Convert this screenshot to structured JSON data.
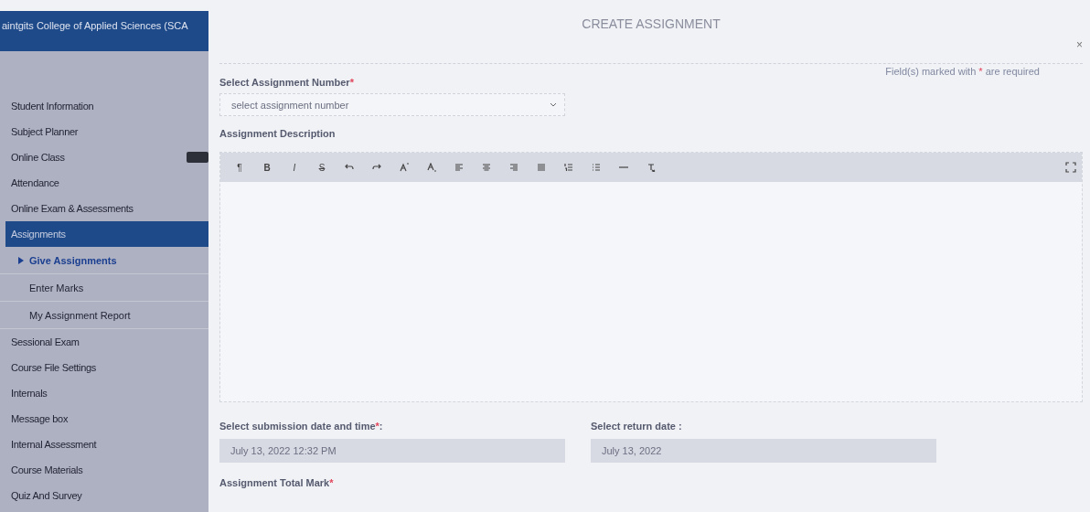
{
  "sidebar": {
    "header": "aintgits College of Applied Sciences (SCA",
    "items": [
      {
        "label": "Student Information",
        "selected": false,
        "badge": false
      },
      {
        "label": "Subject Planner",
        "selected": false,
        "badge": false
      },
      {
        "label": "Online Class",
        "selected": false,
        "badge": true
      },
      {
        "label": "Attendance",
        "selected": false,
        "badge": false
      },
      {
        "label": "Online Exam & Assessments",
        "selected": false,
        "badge": false
      },
      {
        "label": "Assignments",
        "selected": true,
        "badge": false,
        "children": [
          {
            "label": "Give Assignments",
            "selected": true
          },
          {
            "label": "Enter Marks",
            "selected": false
          },
          {
            "label": "My Assignment Report",
            "selected": false
          }
        ]
      },
      {
        "label": "Sessional Exam",
        "selected": false,
        "badge": false
      },
      {
        "label": "Course File Settings",
        "selected": false,
        "badge": false
      },
      {
        "label": "Internals",
        "selected": false,
        "badge": false
      },
      {
        "label": "Message box",
        "selected": false,
        "badge": false
      },
      {
        "label": "Internal Assessment",
        "selected": false,
        "badge": false
      },
      {
        "label": "Course Materials",
        "selected": false,
        "badge": false
      },
      {
        "label": "Quiz And Survey",
        "selected": false,
        "badge": false
      }
    ]
  },
  "dialog": {
    "title": "CREATE ASSIGNMENT",
    "close": "×",
    "required_note": {
      "before": "Field(s) marked with",
      "mark": "*",
      "after": "are required"
    },
    "assignment_number": {
      "label": "Select Assignment Number",
      "mark": "*",
      "placeholder": "select assignment number"
    },
    "description": {
      "label": "Assignment Description",
      "toolbar": [
        {
          "kind": "glyph",
          "label": "¶"
        },
        {
          "kind": "bold",
          "label": "B"
        },
        {
          "kind": "italic",
          "label": "I"
        },
        {
          "kind": "strike",
          "label": "S"
        },
        {
          "kind": "undo"
        },
        {
          "kind": "redo"
        },
        {
          "kind": "superscript"
        },
        {
          "kind": "subscript"
        },
        {
          "kind": "align-left"
        },
        {
          "kind": "align-center"
        },
        {
          "kind": "align-right"
        },
        {
          "kind": "justify"
        },
        {
          "kind": "ordered-list"
        },
        {
          "kind": "bullet-list"
        },
        {
          "kind": "rule"
        },
        {
          "kind": "clear-format"
        }
      ]
    },
    "submission_date": {
      "label": "Select submission date and time",
      "mark": "*",
      "after": ":",
      "value": "July 13, 2022 12:32 PM"
    },
    "return_date": {
      "label": "Select return date :",
      "value": "July 13, 2022"
    },
    "total_mark": {
      "label": "Assignment Total Mark",
      "mark": "*"
    }
  }
}
